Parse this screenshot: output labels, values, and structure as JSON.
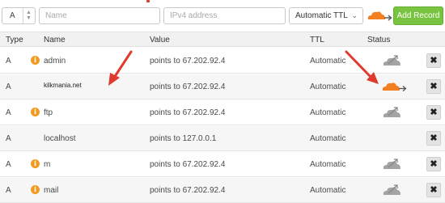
{
  "toolbar": {
    "type_value": "A",
    "name_placeholder": "Name",
    "ip_placeholder": "IPv4 address",
    "ttl_value": "Automatic TTL",
    "add_label": "Add Record"
  },
  "table": {
    "headers": {
      "type": "Type",
      "name": "Name",
      "value": "Value",
      "ttl": "TTL",
      "status": "Status"
    },
    "rows": [
      {
        "type": "A",
        "name": "admin",
        "value": "points to 67.202.92.4",
        "ttl": "Automatic",
        "info": true,
        "status": "grey-cloud"
      },
      {
        "type": "A",
        "name": "kilkmania.net",
        "value": "points to 67.202.92.4",
        "ttl": "Automatic",
        "info": false,
        "status": "orange-cloud"
      },
      {
        "type": "A",
        "name": "ftp",
        "value": "points to 67.202.92.4",
        "ttl": "Automatic",
        "info": true,
        "status": "grey-cloud"
      },
      {
        "type": "A",
        "name": "localhost",
        "value": "points to 127.0.0.1",
        "ttl": "Automatic",
        "info": false,
        "status": "none"
      },
      {
        "type": "A",
        "name": "m",
        "value": "points to 67.202.92.4",
        "ttl": "Automatic",
        "info": true,
        "status": "grey-cloud"
      },
      {
        "type": "A",
        "name": "mail",
        "value": "points to 67.202.92.4",
        "ttl": "Automatic",
        "info": true,
        "status": "grey-cloud"
      }
    ]
  },
  "icons": {
    "info": "i",
    "delete": "✖",
    "toolbar_cloud": "orange-cloud-icon"
  },
  "colors": {
    "accent_green": "#78c33f",
    "cloud_orange": "#f38020",
    "cloud_grey": "#a4a4a4",
    "info_orange": "#f29b21",
    "annotation_red": "#e03a2e"
  }
}
